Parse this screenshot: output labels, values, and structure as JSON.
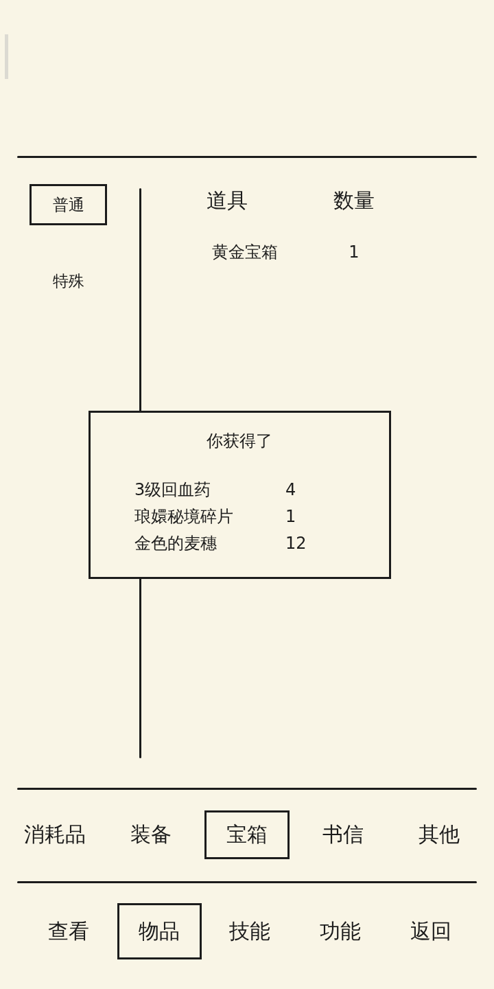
{
  "sub_tabs": [
    {
      "label": "普通",
      "selected": true
    },
    {
      "label": "特殊",
      "selected": false
    }
  ],
  "table": {
    "columns": [
      "道具",
      "数量"
    ],
    "rows": [
      {
        "item": "黄金宝箱",
        "count": "1"
      }
    ]
  },
  "dialog": {
    "title": "你获得了",
    "rows": [
      {
        "item": "3级回血药",
        "count": "4"
      },
      {
        "item": "琅嬛秘境碎片",
        "count": "1"
      },
      {
        "item": "金色的麦穗",
        "count": "12"
      }
    ]
  },
  "category_tabs": [
    {
      "label": "消耗品",
      "selected": false
    },
    {
      "label": "装备",
      "selected": false
    },
    {
      "label": "宝箱",
      "selected": true
    },
    {
      "label": "书信",
      "selected": false
    },
    {
      "label": "其他",
      "selected": false
    }
  ],
  "nav_tabs": [
    {
      "label": "查看",
      "selected": false
    },
    {
      "label": "物品",
      "selected": true
    },
    {
      "label": "技能",
      "selected": false
    },
    {
      "label": "功能",
      "selected": false
    },
    {
      "label": "返回",
      "selected": false
    }
  ]
}
